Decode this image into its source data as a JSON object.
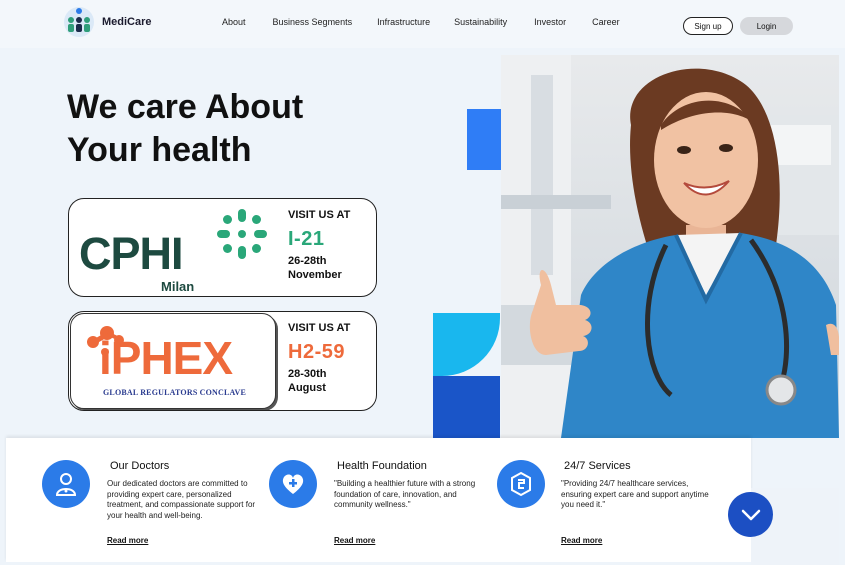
{
  "brand": {
    "name": "MediCare"
  },
  "nav": {
    "items": [
      "About",
      "Business Segments",
      "Infrastructure",
      "Sustainability",
      "Investor",
      "Career"
    ]
  },
  "auth": {
    "signup": "Sign up",
    "login": "Login"
  },
  "hero": {
    "title_line1": "We care About",
    "title_line2": "Your health"
  },
  "events": [
    {
      "logo_text": "CPHI",
      "logo_sub": "Milan",
      "visit": "VISIT US AT",
      "booth": "I-21",
      "booth_color": "#2aa779",
      "dates_line1": "26-28th",
      "dates_line2": "November"
    },
    {
      "logo_text": "iPHEX",
      "logo_sub": "GLOBAL REGULATORS CONCLAVE",
      "visit": "VISIT US AT",
      "booth": "H2-59",
      "booth_color": "#ee6a3b",
      "dates_line1": "28-30th",
      "dates_line2": "August"
    }
  ],
  "services": [
    {
      "icon": "doctor-icon",
      "title": "Our Doctors",
      "desc": "Our dedicated doctors are committed to providing expert care, personalized treatment, and compassionate support for your health and well-being.",
      "link": "Read more"
    },
    {
      "icon": "heart-plus-icon",
      "title": "Health Foundation",
      "desc": "\"Building a healthier future with a strong foundation of care, innovation, and community wellness.\"",
      "link": "Read more"
    },
    {
      "icon": "shield-icon",
      "title": "24/7 Services",
      "desc": "\"Providing 24/7 healthcare services, ensuring expert care and support anytime you need it.\"",
      "link": "Read more"
    }
  ],
  "colors": {
    "accent": "#2b7be8",
    "dark_accent": "#1c4fc3",
    "cphi_green": "#1d4a40",
    "iphex_orange": "#ee6a3b"
  }
}
